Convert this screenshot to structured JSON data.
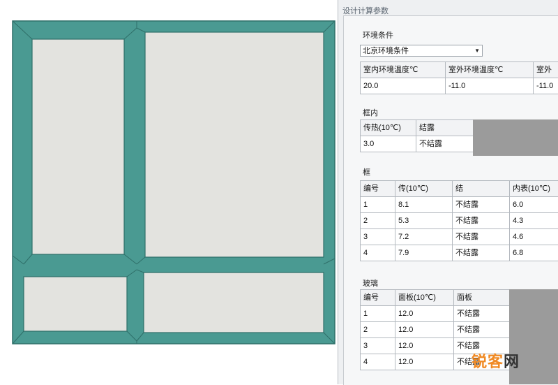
{
  "colors": {
    "frame": "#4a9a92",
    "frame_edge": "#2f6f69",
    "glass": "#e3e3df",
    "dialog_bg": "#eef0f2",
    "placeholder_gray": "#9b9b9b",
    "watermark_orange": "#f08a24"
  },
  "dialog": {
    "title": "设计计算参数",
    "env": {
      "title": "环境条件",
      "combo_value": "北京环境条件",
      "headers": [
        "室内环境温度℃",
        "室外环境温度℃",
        "室外"
      ],
      "row": [
        "20.0",
        "-11.0",
        "-11.0"
      ]
    },
    "frame_section": {
      "title": "框内",
      "headers": [
        "传热(10℃)",
        "结露"
      ],
      "row": [
        "3.0",
        "不结露"
      ]
    },
    "glass_section": {
      "title": "框",
      "headers": [
        "编号",
        "传(10℃)",
        "结",
        "内表(10℃)"
      ],
      "rows": [
        [
          "1",
          "8.1",
          "不结露",
          "6.0"
        ],
        [
          "2",
          "5.3",
          "不结露",
          "4.3"
        ],
        [
          "3",
          "7.2",
          "不结露",
          "4.6"
        ],
        [
          "4",
          "7.9",
          "不结露",
          "6.8"
        ]
      ]
    },
    "panel_section": {
      "title": "玻璃",
      "headers": [
        "编号",
        "面板(10℃)",
        "面板"
      ],
      "rows": [
        [
          "1",
          "12.0",
          "不结露"
        ],
        [
          "2",
          "12.0",
          "不结露"
        ],
        [
          "3",
          "12.0",
          "不结露"
        ],
        [
          "4",
          "12.0",
          "不结露"
        ]
      ]
    }
  },
  "watermark": {
    "part1": "锐客",
    "part2": "网"
  }
}
